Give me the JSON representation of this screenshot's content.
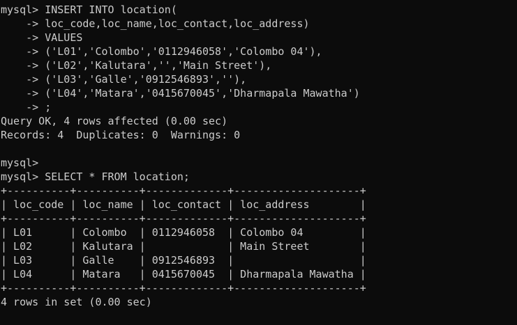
{
  "terminal": {
    "colors": {
      "background": "#0c0c0c",
      "foreground": "#cccccc"
    },
    "lines": [
      "mysql> INSERT INTO location(",
      "    -> loc_code,loc_name,loc_contact,loc_address)",
      "    -> VALUES",
      "    -> ('L01','Colombo','0112946058','Colombo 04'),",
      "    -> ('L02','Kalutara','','Main Street'),",
      "    -> ('L03','Galle','0912546893',''),",
      "    -> ('L04','Matara','0415670045','Dharmapala Mawatha')",
      "    -> ;",
      "Query OK, 4 rows affected (0.00 sec)",
      "Records: 4  Duplicates: 0  Warnings: 0",
      "",
      "mysql>",
      "mysql> SELECT * FROM location;",
      "+----------+----------+-------------+--------------------+",
      "| loc_code | loc_name | loc_contact | loc_address        |",
      "+----------+----------+-------------+--------------------+",
      "| L01      | Colombo  | 0112946058  | Colombo 04         |",
      "| L02      | Kalutara |             | Main Street        |",
      "| L03      | Galle    | 0912546893  |                    |",
      "| L04      | Matara   | 0415670045  | Dharmapala Mawatha |",
      "+----------+----------+-------------+--------------------+",
      "4 rows in set (0.00 sec)"
    ]
  }
}
